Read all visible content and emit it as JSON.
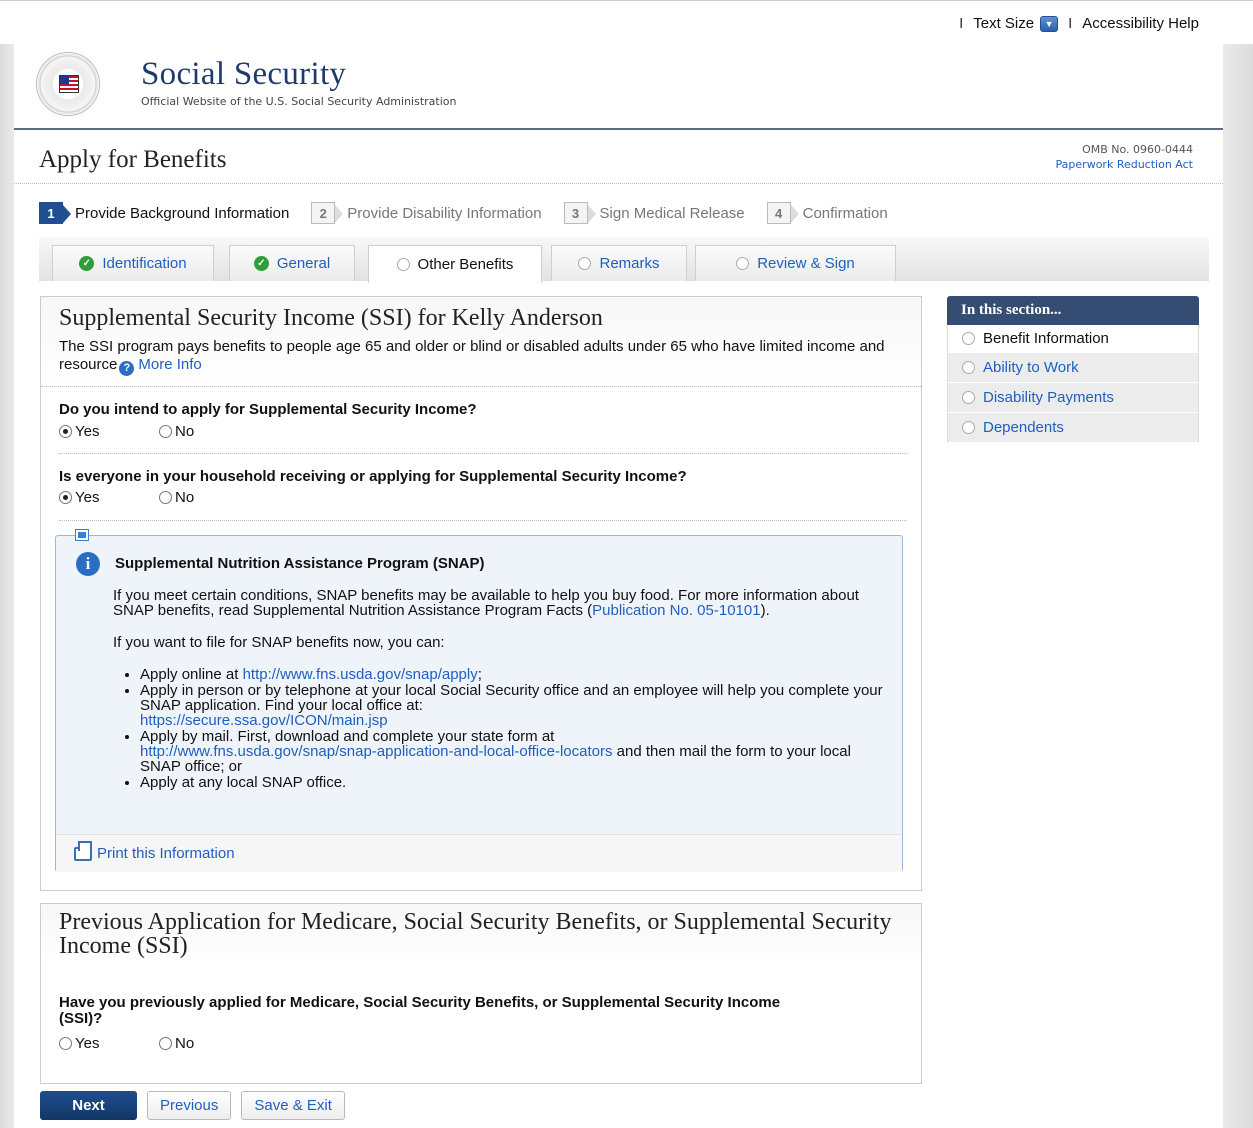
{
  "utility": {
    "sep": "I",
    "text_size": "Text Size",
    "accessibility": "Accessibility Help"
  },
  "header": {
    "name": "Social Security",
    "tagline": "Official Website of the U.S. Social Security Administration",
    "seal_text": "SOCIAL SECURITY ADMINISTRATION USA"
  },
  "page": {
    "title": "Apply for Benefits",
    "omb": "OMB No. 0960-0444",
    "paperwork": "Paperwork Reduction Act"
  },
  "steps": [
    {
      "num": "1",
      "label": "Provide Background Information"
    },
    {
      "num": "2",
      "label": "Provide Disability Information"
    },
    {
      "num": "3",
      "label": "Sign Medical Release"
    },
    {
      "num": "4",
      "label": "Confirmation"
    }
  ],
  "tabs": [
    {
      "label": "Identification",
      "status": "complete"
    },
    {
      "label": "General",
      "status": "complete"
    },
    {
      "label": "Other Benefits",
      "status": "current"
    },
    {
      "label": "Remarks",
      "status": "pending"
    },
    {
      "label": "Review & Sign",
      "status": "pending"
    }
  ],
  "ssi": {
    "title": "Supplemental Security Income (SSI) for Kelly Anderson",
    "desc": "The SSI program pays benefits to people age 65 and older or blind or disabled adults under 65 who have limited income and resource",
    "more_info": "More Info",
    "q1": "Do you intend to apply for Supplemental Security Income?",
    "q2": "Is everyone in your household receiving or applying for Supplemental Security Income?",
    "yes": "Yes",
    "no": "No",
    "q1_answer": "Yes",
    "q2_answer": "Yes"
  },
  "snap": {
    "title": "Supplemental Nutrition Assistance Program (SNAP)",
    "p1_a": "If you meet certain conditions, SNAP benefits may be available to help you buy food. For more information about SNAP benefits, read Supplemental Nutrition Assistance Program Facts (",
    "p1_link": "Publication No. 05-10101",
    "p1_b": ").",
    "p2": "If you want to file for SNAP benefits now, you can:",
    "b1_a": "Apply online at ",
    "b1_link": "http://www.fns.usda.gov/snap/apply",
    "b1_b": ";",
    "b2_a": "Apply in person or by telephone at your local Social Security office and an employee will help you complete your SNAP application.  Find your local office at:",
    "b2_link": "https://secure.ssa.gov/ICON/main.jsp",
    "b3_a": "Apply by mail. First, download and complete your state form at",
    "b3_link": "http://www.fns.usda.gov/snap/snap-application-and-local-office-locators",
    "b3_b": " and then mail the form to your local SNAP office; or",
    "b4": "Apply at any local SNAP office.",
    "print": "Print this Information"
  },
  "prev": {
    "title": "Previous Application for Medicare, Social Security Benefits, or Supplemental Security Income (SSI)",
    "q": "Have you previously applied for Medicare, Social Security Benefits, or Supplemental Security Income (SSI)?",
    "yes": "Yes",
    "no": "No"
  },
  "sidebar": {
    "head": "In this section...",
    "items": [
      {
        "label": "Benefit Information",
        "current": true
      },
      {
        "label": "Ability to Work",
        "current": false
      },
      {
        "label": "Disability Payments",
        "current": false
      },
      {
        "label": "Dependents",
        "current": false
      }
    ]
  },
  "buttons": {
    "next": "Next",
    "previous": "Previous",
    "save_exit": "Save & Exit"
  },
  "colors": {
    "brand_navy": "#203a6b",
    "link_blue": "#1f5fbf",
    "sidebar_head": "#354d73",
    "check_green": "#2e9d3a"
  }
}
